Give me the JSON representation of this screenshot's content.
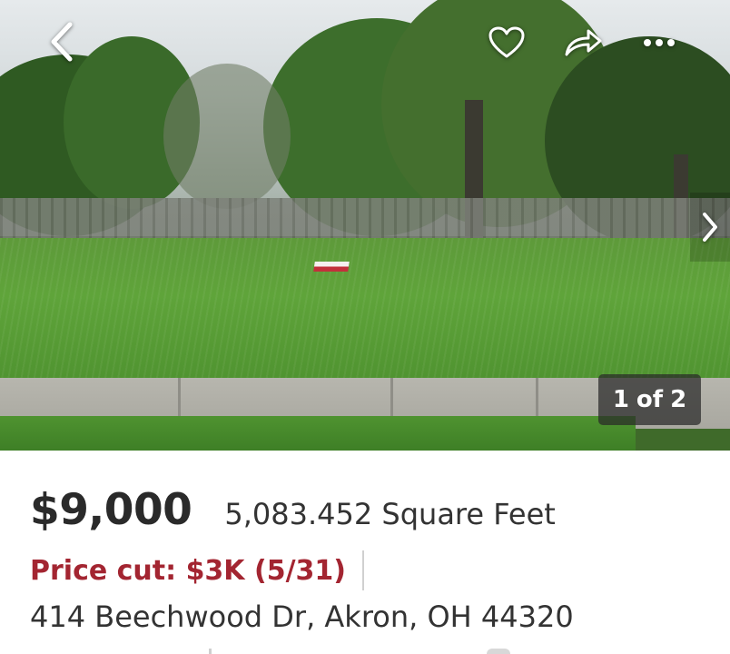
{
  "photo": {
    "counter": {
      "current": "1",
      "separator": "of",
      "total": "2"
    },
    "icons": {
      "back": "chevron-left-icon",
      "favorite": "heart-icon",
      "share": "share-arrow-icon",
      "more": "more-dots-icon",
      "next": "chevron-right-icon"
    }
  },
  "listing": {
    "price": "$9,000",
    "area": "5,083.452 Square Feet",
    "price_cut": "Price cut: $3K (5/31)",
    "address": "414 Beechwood Dr, Akron, OH 44320"
  },
  "colors": {
    "price_cut": "#a32531",
    "text": "#2a2a2a",
    "counter_bg": "rgba(40,40,40,0.72)"
  }
}
